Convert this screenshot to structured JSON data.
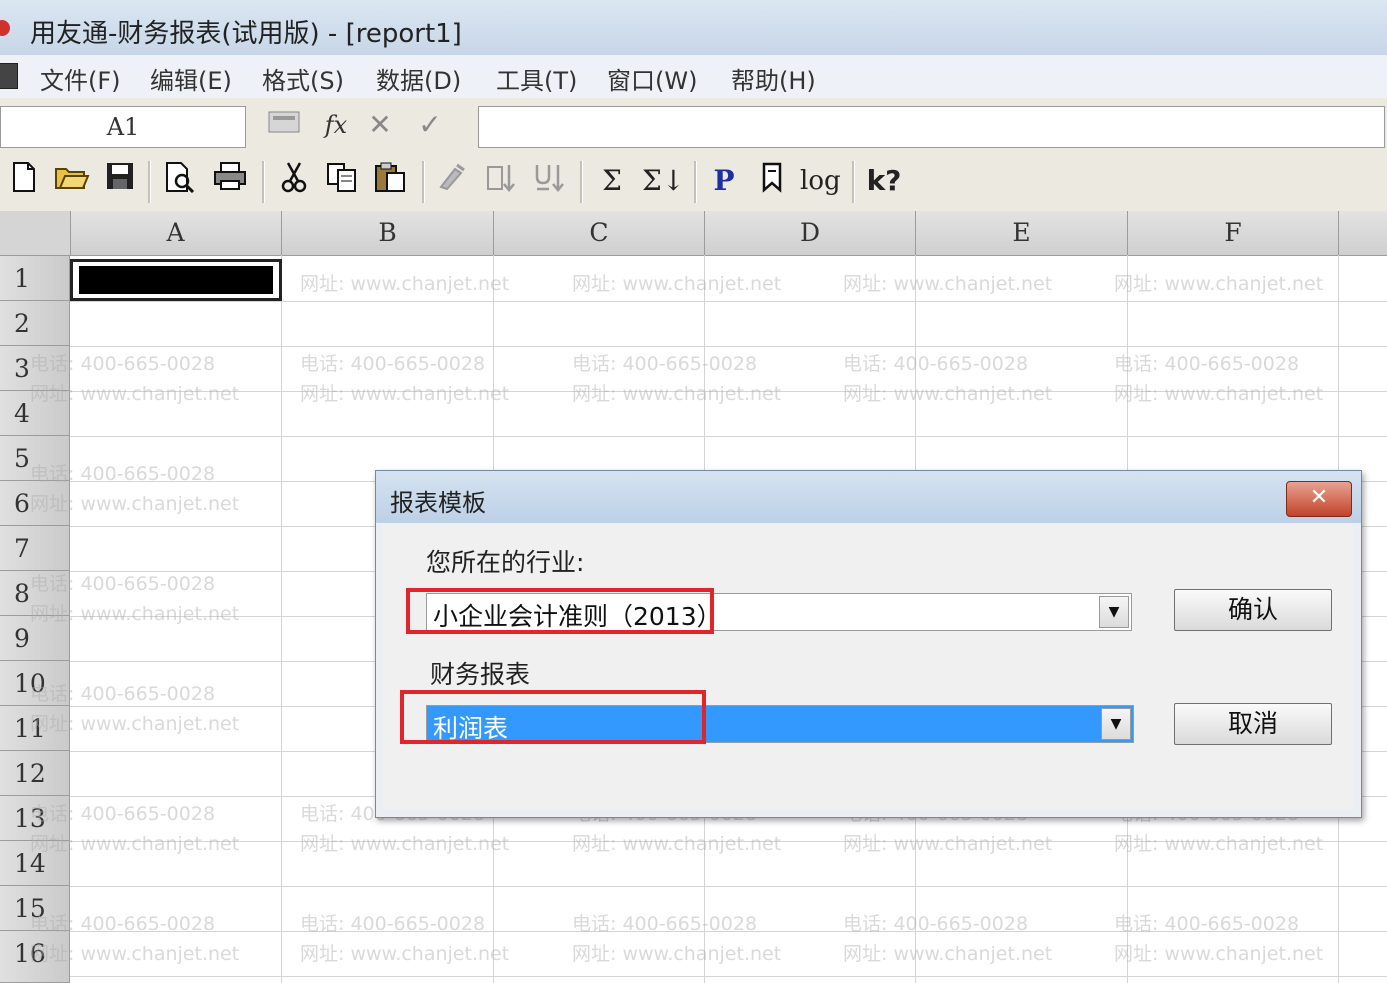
{
  "window": {
    "title": "用友通-财务报表(试用版) - [report1]"
  },
  "menu": [
    "文件(F)",
    "编辑(E)",
    "格式(S)",
    "数据(D)",
    "工具(T)",
    "窗口(W)",
    "帮助(H)"
  ],
  "formula_bar": {
    "cell_ref": "A1",
    "fx_label": "fx",
    "cancel_symbol": "✕",
    "confirm_symbol": "✓",
    "formula": ""
  },
  "toolbar": {
    "sum_label": "Σ",
    "sum2_label": "Σ↓",
    "p_label": "P",
    "log_label": "log",
    "help_label": "k?"
  },
  "grid": {
    "columns": [
      "A",
      "B",
      "C",
      "D",
      "E",
      "F"
    ],
    "rows": [
      "1",
      "2",
      "3",
      "4",
      "5",
      "6",
      "7",
      "8",
      "9",
      "10",
      "11",
      "12",
      "13",
      "14",
      "15",
      "16"
    ]
  },
  "watermark": {
    "phone": "电话: 400-665-0028",
    "site": "网址: www.chanjet.net"
  },
  "dialog": {
    "title": "报表模板",
    "close_symbol": "✕",
    "industry_label": "您所在的行业:",
    "industry_value": "小企业会计准则（2013）",
    "report_label": "财务报表",
    "report_value": "利润表",
    "confirm_button": "确认",
    "cancel_button": "取消"
  },
  "icons": [
    "new-file-icon",
    "open-folder-icon",
    "save-icon",
    "print-preview-icon",
    "print-icon",
    "cut-icon",
    "copy-icon",
    "paste-icon",
    "format-painter-icon",
    "sort-ascending-icon",
    "sort-descending-icon",
    "sum-icon",
    "sum-down-icon",
    "p-icon",
    "bookmark-icon",
    "log-icon",
    "help-pointer-icon"
  ],
  "colors": {
    "highlight": "#e0262b",
    "selection": "#3399ff"
  }
}
